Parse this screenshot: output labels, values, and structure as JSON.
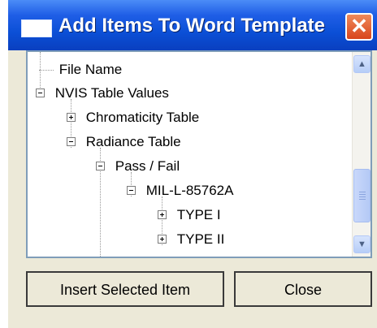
{
  "window": {
    "title": "Add Items To Word Template",
    "close_glyph": "✕"
  },
  "tree": {
    "items": [
      {
        "label": "File Name",
        "node": "leaf"
      },
      {
        "label": "NVIS Table Values",
        "node": "expanded"
      },
      {
        "label": "Chromaticity Table",
        "node": "collapsed"
      },
      {
        "label": "Radiance Table",
        "node": "expanded"
      },
      {
        "label": "Pass / Fail",
        "node": "expanded"
      },
      {
        "label": "MIL-L-85762A",
        "node": "expanded"
      },
      {
        "label": "TYPE I",
        "node": "collapsed"
      },
      {
        "label": "TYPE II",
        "node": "collapsed"
      }
    ]
  },
  "scrollbar": {
    "up_glyph": "▲",
    "down_glyph": "▼"
  },
  "buttons": {
    "insert": "Insert Selected Item",
    "close": "Close"
  },
  "colors": {
    "titlebar": "#0b4fd6",
    "close_button": "#d8451c",
    "window_bg": "#ece9d8"
  },
  "icons": {
    "window": "window-icon",
    "close": "close-icon",
    "expand": "plus-box-icon",
    "collapse": "minus-box-icon",
    "scroll_up": "chevron-up-icon",
    "scroll_down": "chevron-down-icon"
  }
}
